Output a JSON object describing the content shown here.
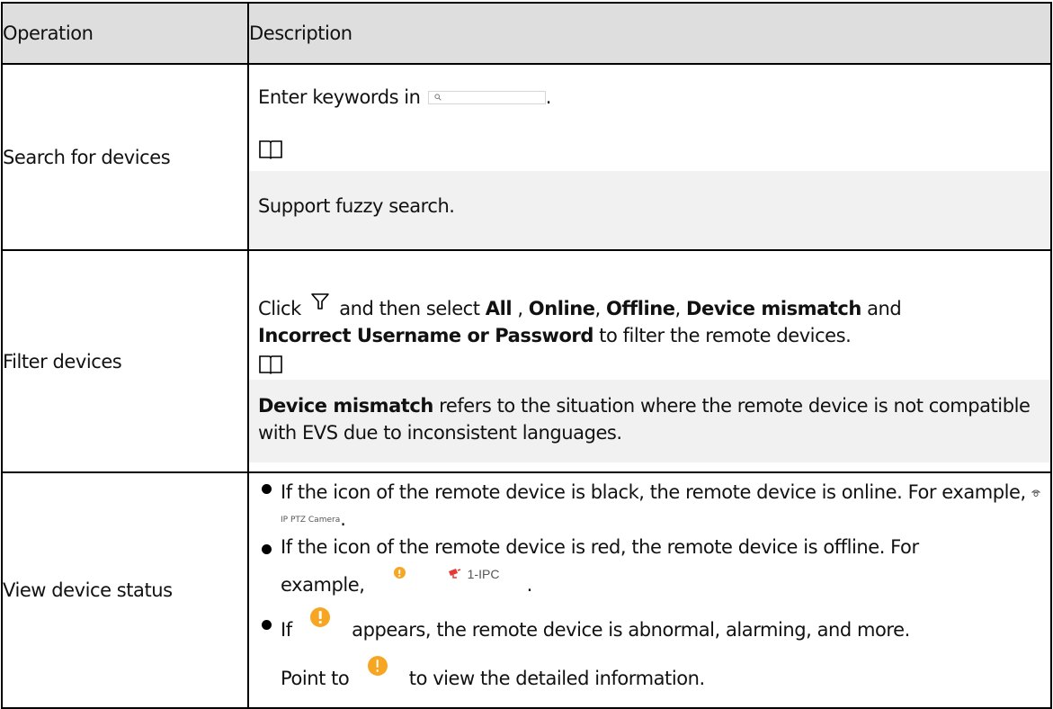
{
  "table": {
    "headers": [
      "Operation",
      "Description"
    ],
    "rows": [
      {
        "operation": "Search for devices",
        "line1_before": "Enter keywords in",
        "line1_after": ".",
        "note": "Support fuzzy search."
      },
      {
        "operation": "Filter devices",
        "click": "Click",
        "then": "and then select",
        "opt_all": "All",
        "sep1": ",",
        "opt_online": "Online",
        "sep2": ",",
        "opt_offline": "Offline",
        "sep3": ",",
        "opt_mismatch": "Device mismatch",
        "and": "and",
        "opt_incorrect": "Incorrect Username or Password",
        "tail": "to filter the remote devices.",
        "note_bold": "Device mismatch",
        "note_rest": "refers to the situation where the remote device is not compatible with EVS due to inconsistent languages."
      },
      {
        "operation": "View device status",
        "b1_text": "If the icon of the remote device is black, the remote device is online. For example,",
        "b1_cam_label": "IP PTZ Camera",
        "b1_end": ".",
        "b2_line1": "If the icon of the remote device is red, the remote device is offline. For",
        "b2_line2": "example,",
        "b2_ipc_label": "1-IPC",
        "b2_end": ".",
        "b3_if": "If",
        "b3_rest": "appears, the remote device is abnormal, alarming, and more.",
        "b3_point": "Point to",
        "b3_view": "to view the detailed information."
      }
    ]
  },
  "colors": {
    "header_bg": "#dedede",
    "note_bg": "#f1f1f1",
    "warning": "#f6a623",
    "offline_red": "#e53935"
  },
  "icons": [
    "note-book-icon",
    "search-icon",
    "filter-icon",
    "warning-icon",
    "ptz-camera-icon",
    "camera-offline-icon"
  ]
}
